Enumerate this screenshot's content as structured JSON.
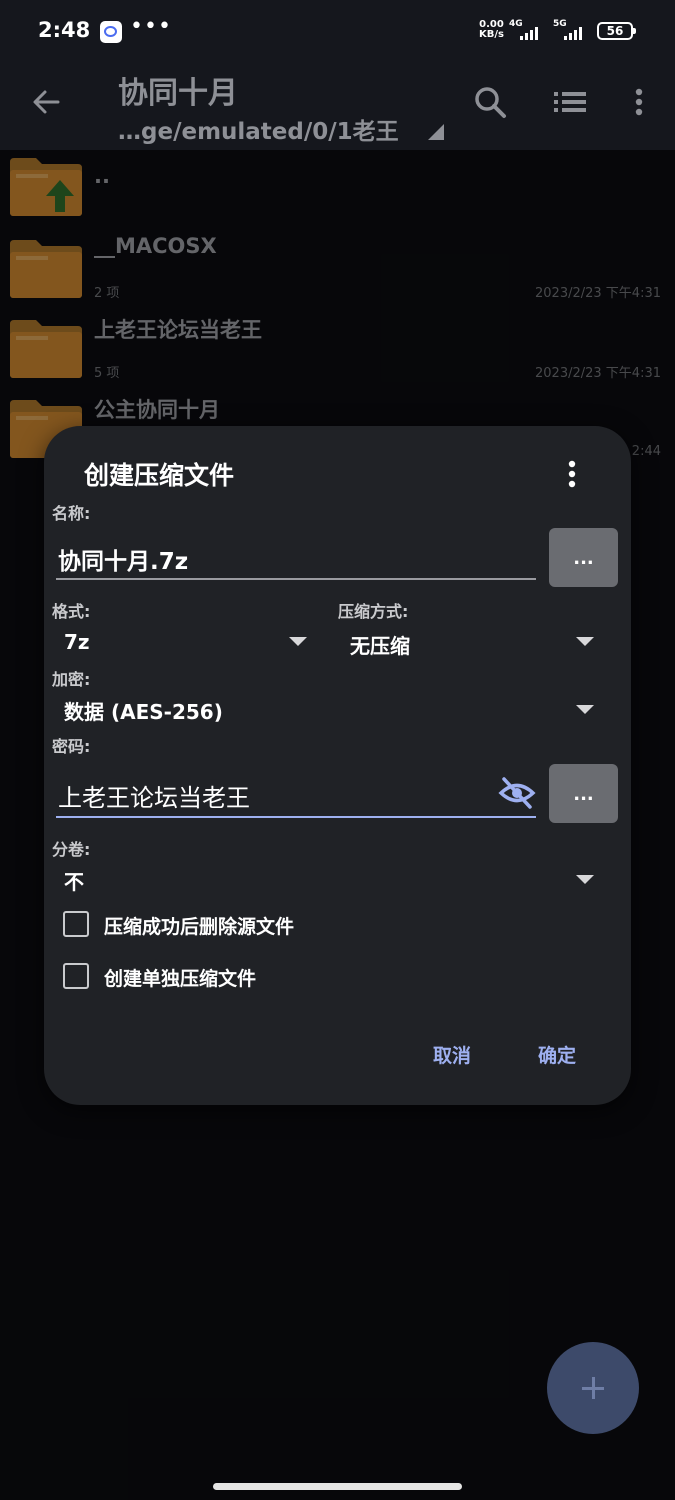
{
  "status_bar": {
    "time": "2:48",
    "dots": "•••",
    "speed_value": "0.00",
    "speed_unit": "KB/s",
    "net1": "4G",
    "net2": "5G",
    "battery": "56"
  },
  "toolbar": {
    "title": "协同十月",
    "path": "…ge/emulated/0/1老王",
    "icons": [
      "back-arrow-icon",
      "search-icon",
      "list-view-icon",
      "more-vert-icon"
    ]
  },
  "files": [
    {
      "name": "..",
      "count": "",
      "date": "",
      "icon": "folder-up-icon"
    },
    {
      "name": "__MACOSX",
      "count": "2 项",
      "date": "2023/2/23 下午4:31",
      "icon": "folder-icon"
    },
    {
      "name": "上老王论坛当老王",
      "count": "5 项",
      "date": "2023/2/23 下午4:31",
      "icon": "folder-icon"
    },
    {
      "name": "公主协同十月",
      "count": "",
      "date": "2:44",
      "icon": "folder-icon"
    }
  ],
  "dialog": {
    "title": "创建压缩文件",
    "name_label": "名称:",
    "name_value": "协同十月.7z",
    "browse_label": "...",
    "format_label": "格式:",
    "format_value": "7z",
    "method_label": "压缩方式:",
    "method_value": "无压缩",
    "encryption_label": "加密:",
    "encryption_value": "数据 (AES-256)",
    "password_label": "密码:",
    "password_value": "上老王论坛当老王",
    "password_dots_label": "...",
    "split_label": "分卷:",
    "split_value": "不",
    "option_delete": {
      "label": "压缩成功后删除源文件",
      "checked": false
    },
    "option_separate": {
      "label": "创建单独压缩文件",
      "checked": false
    },
    "cancel_label": "取消",
    "ok_label": "确定"
  },
  "colors": {
    "accent": "#9eb0f0",
    "dialog_bg": "#202226",
    "folder": "#c9852f"
  }
}
